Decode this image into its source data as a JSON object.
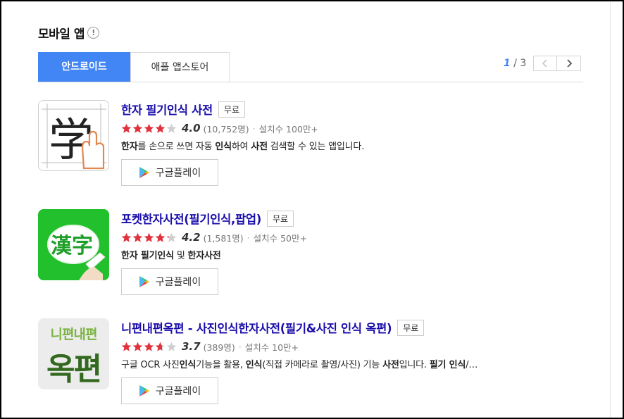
{
  "section": {
    "title": "모바일 앱",
    "info_glyph": "!"
  },
  "tabs": [
    {
      "label": "안드로이드",
      "active": true
    },
    {
      "label": "애플 앱스토어",
      "active": false
    }
  ],
  "pager": {
    "current": "1",
    "separator": " / ",
    "total": "3"
  },
  "colors": {
    "accent": "#4285f4",
    "link": "#1a0dab",
    "star": "#e0323c"
  },
  "apps": [
    {
      "title": "한자 필기인식 사전",
      "badge": "무료",
      "rating": 4.0,
      "score": "4.0",
      "reviews": "(10,752명)",
      "installs": "설치수 100만+",
      "desc_parts": [
        {
          "t": "한자",
          "b": true
        },
        {
          "t": "를 손으로 쓰면 자동 ",
          "b": false
        },
        {
          "t": "인식",
          "b": true
        },
        {
          "t": "하여 ",
          "b": false
        },
        {
          "t": "사전",
          "b": true
        },
        {
          "t": " 검색할 수 있는 앱입니다.",
          "b": false
        }
      ],
      "icon": "hanja-hand-icon",
      "button": "구글플레이"
    },
    {
      "title": "포켓한자사전(필기인식,팝업)",
      "badge": "무료",
      "rating": 4.2,
      "score": "4.2",
      "reviews": "(1,581명)",
      "installs": "설치수 50만+",
      "desc_parts": [
        {
          "t": "한자 필기인식",
          "b": true
        },
        {
          "t": " 및 ",
          "b": false
        },
        {
          "t": "한자사전",
          "b": true
        }
      ],
      "icon": "pocket-hanja-icon",
      "button": "구글플레이"
    },
    {
      "title": "니편내편옥편 - 사진인식한자사전(필기&사진 인식 옥편)",
      "badge": "무료",
      "rating": 3.7,
      "score": "3.7",
      "reviews": "(389명)",
      "installs": "설치수 10만+",
      "desc_parts": [
        {
          "t": "구글 OCR 사진",
          "b": false
        },
        {
          "t": "인식",
          "b": true
        },
        {
          "t": "기능을 활용, ",
          "b": false
        },
        {
          "t": "인식",
          "b": true
        },
        {
          "t": "(직접 카메라로 촬영/사진) 기능 ",
          "b": false
        },
        {
          "t": "사전",
          "b": true
        },
        {
          "t": "입니다. ",
          "b": false
        },
        {
          "t": "필기 인식",
          "b": true
        },
        {
          "t": "/…",
          "b": false
        }
      ],
      "icon": "okpyeon-icon",
      "icon_text_top": "니편내편",
      "icon_text_bottom": "옥편",
      "button": "구글플레이"
    }
  ]
}
